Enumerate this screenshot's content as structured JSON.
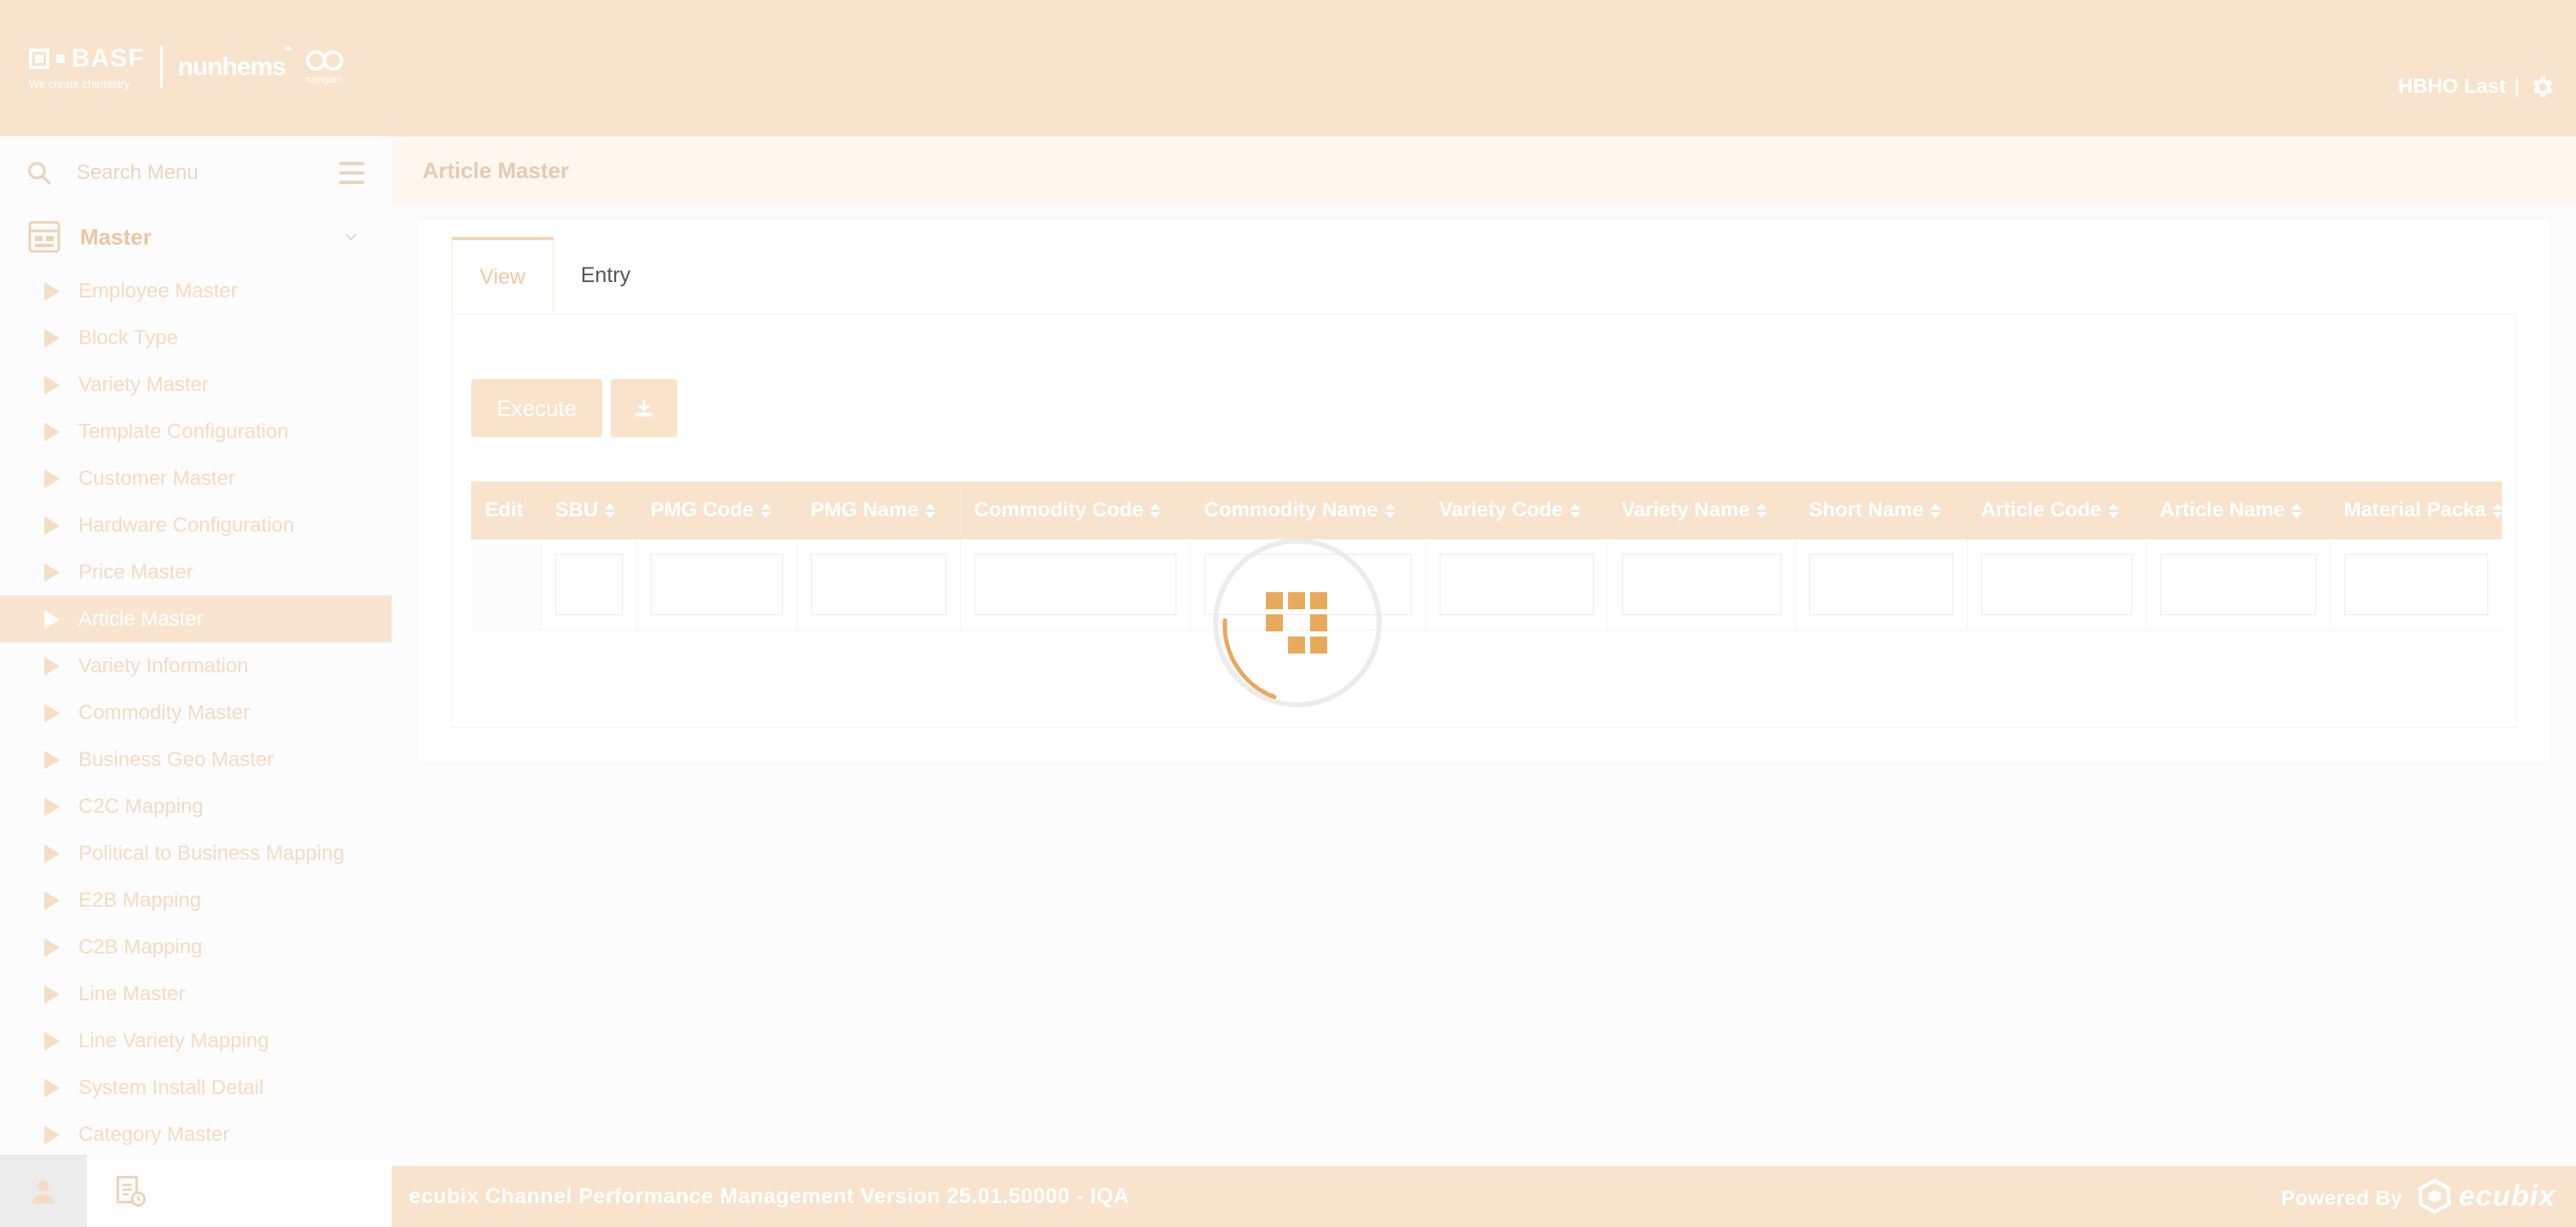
{
  "header": {
    "basf_logo": "BASF",
    "basf_tagline": "We create chemistry",
    "nunhems_logo": "nunhems",
    "sangam_logo": "sangam",
    "user_name": "HBHO Last",
    "user_separator": "|"
  },
  "sidebar": {
    "search_placeholder": "Search Menu",
    "section_title": "Master",
    "items": [
      {
        "label": "Employee Master",
        "active": false
      },
      {
        "label": "Block Type",
        "active": false
      },
      {
        "label": "Variety Master",
        "active": false
      },
      {
        "label": "Template Configuration",
        "active": false
      },
      {
        "label": "Customer Master",
        "active": false
      },
      {
        "label": "Hardware Configuration",
        "active": false
      },
      {
        "label": "Price Master",
        "active": false
      },
      {
        "label": "Article Master",
        "active": true
      },
      {
        "label": "Variety Information",
        "active": false
      },
      {
        "label": "Commodity Master",
        "active": false
      },
      {
        "label": "Business Geo Master",
        "active": false
      },
      {
        "label": "C2C Mapping",
        "active": false
      },
      {
        "label": "Political to Business Mapping",
        "active": false
      },
      {
        "label": "E2B Mapping",
        "active": false
      },
      {
        "label": "C2B Mapping",
        "active": false
      },
      {
        "label": "Line Master",
        "active": false
      },
      {
        "label": "Line Variety Mapping",
        "active": false
      },
      {
        "label": "System Install Detail",
        "active": false
      },
      {
        "label": "Category Master",
        "active": false
      }
    ]
  },
  "main": {
    "page_title": "Article Master",
    "tabs": [
      {
        "label": "View",
        "active": true
      },
      {
        "label": "Entry",
        "active": false
      }
    ],
    "execute_label": "Execute",
    "table": {
      "columns": [
        "Edit",
        "SBU",
        "PMG Code",
        "PMG Name",
        "Commodity Code",
        "Commodity Name",
        "Variety Code",
        "Variety Name",
        "Short Name",
        "Article Code",
        "Article Name",
        "Material Packa"
      ]
    }
  },
  "footer": {
    "version_text": "ecubix Channel Performance Management Version 25.01.50000 - IQA",
    "powered_by": "Powered By",
    "brand": "ecubix"
  },
  "colors": {
    "accent": "#f8e3cc",
    "loader": "#e9a95a",
    "active_tab_text": "#f3c9a1"
  }
}
